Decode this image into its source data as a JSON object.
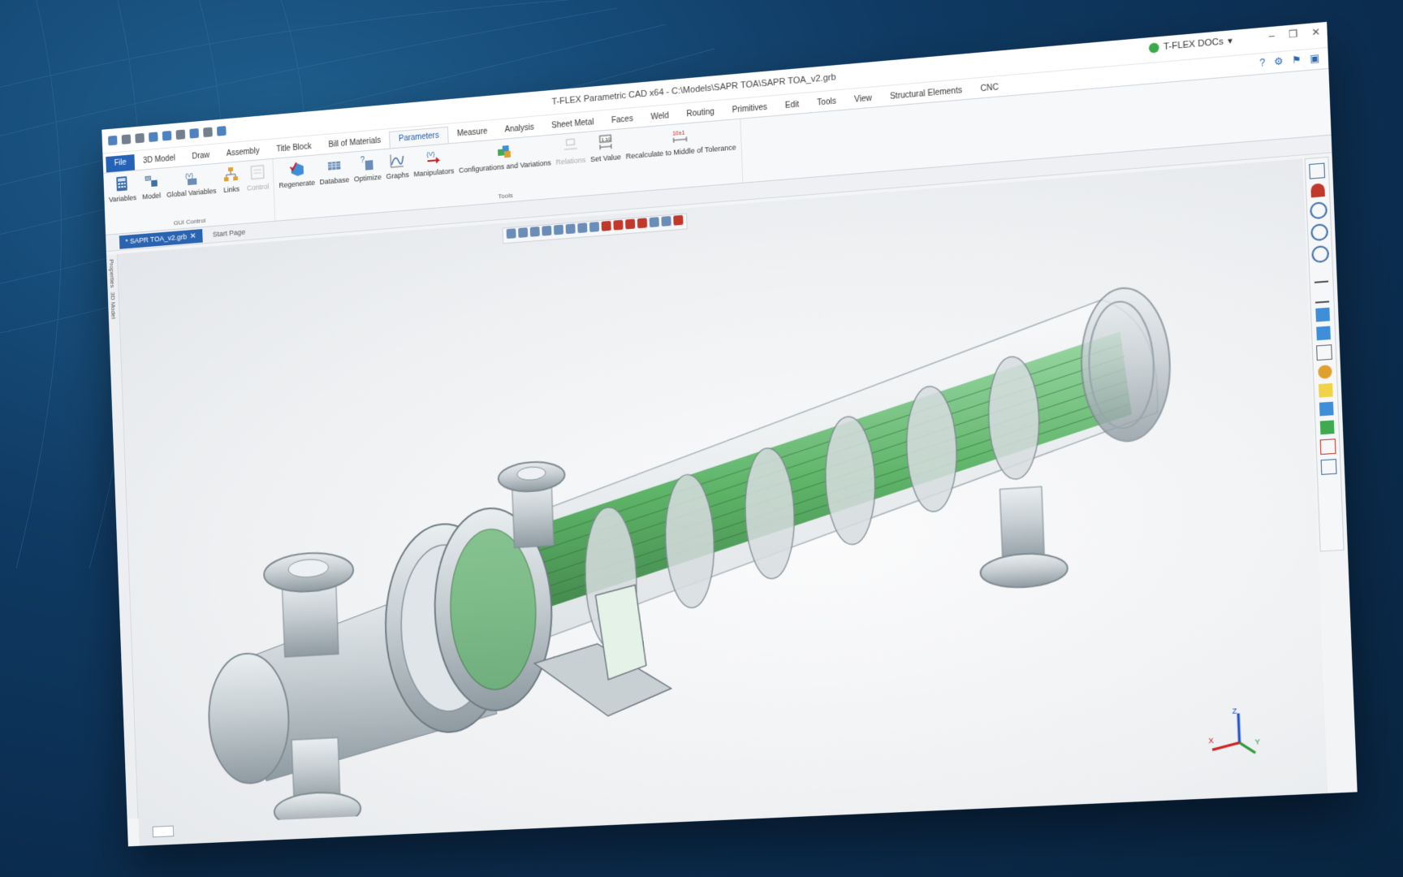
{
  "app": {
    "title": "T-FLEX Parametric CAD x64 - C:\\Models\\SAPR TOA\\SAPR TOA_v2.grb",
    "docs_label": "T-FLEX DOCs",
    "docs_caret": "▾"
  },
  "window_controls": {
    "minimize": "–",
    "restore": "❐",
    "close": "✕"
  },
  "menu": {
    "tabs": [
      "File",
      "3D Model",
      "Draw",
      "Assembly",
      "Title Block",
      "Bill of Materials",
      "Parameters",
      "Measure",
      "Analysis",
      "Sheet Metal",
      "Faces",
      "Weld",
      "Routing",
      "Primitives",
      "Edit",
      "Tools",
      "View",
      "Structural Elements",
      "CNC"
    ],
    "active": "Parameters"
  },
  "ribbon": {
    "gui_control": {
      "name": "GUI Control",
      "buttons": [
        "Variables",
        "Model",
        "Global Variables",
        "Links",
        "Control"
      ]
    },
    "tools": {
      "name": "Tools",
      "buttons": [
        "Regenerate",
        "Database",
        "Optimize",
        "Graphs",
        "Manipulators",
        "Configurations and Variations",
        "Relations",
        "Set Value",
        "Recalculate to Middle of Tolerance"
      ]
    }
  },
  "doc_tabs": {
    "active": "* SAPR TOA_v2.grb",
    "other": "Start Page"
  },
  "side_labels": {
    "properties": "Properties",
    "model3d": "3D Model"
  },
  "axes": {
    "z": "Z",
    "x": "X",
    "y": "Y"
  },
  "colors": {
    "accent": "#2563b7",
    "tubes": "#4fae5a",
    "metal": "#b9c0c6"
  },
  "icons": [
    "calculator-icon",
    "model-variables-icon",
    "global-variables-icon",
    "links-icon",
    "control-icon",
    "regenerate-icon",
    "database-icon",
    "optimize-icon",
    "graphs-icon",
    "manipulators-icon",
    "configurations-icon",
    "relations-icon",
    "set-value-icon",
    "tolerance-icon"
  ]
}
